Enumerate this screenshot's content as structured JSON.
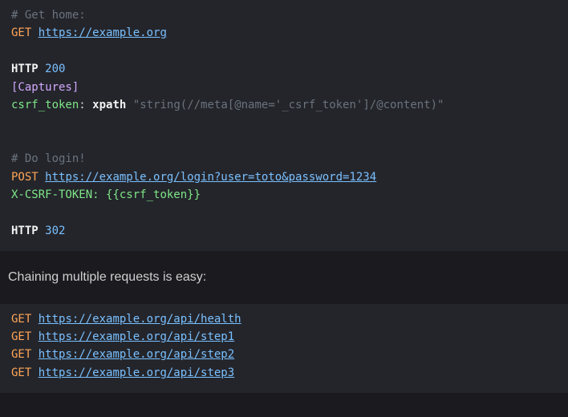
{
  "block1": {
    "comment1": "# Get home:",
    "method1": "GET",
    "url1": "https://example.org",
    "http1_kw": "HTTP",
    "http1_code": "200",
    "section": "[Captures]",
    "cap_ident": "csrf_token",
    "cap_colon": ":",
    "cap_func": "xpath",
    "cap_string": "\"string(//meta[@name='_csrf_token']/@content)\"",
    "comment2": "# Do login!",
    "method2": "POST",
    "url2": "https://example.org/login?user=toto&password=1234",
    "header_name": "X-CSRF-TOKEN",
    "header_sep": ": ",
    "header_val": "{{csrf_token}}",
    "http2_kw": "HTTP",
    "http2_code": "302"
  },
  "prose": {
    "text": "Chaining multiple requests is easy:"
  },
  "block2": {
    "m": "GET",
    "u1": "https://example.org/api/health",
    "u2": "https://example.org/api/step1",
    "u3": "https://example.org/api/step2",
    "u4": "https://example.org/api/step3"
  }
}
